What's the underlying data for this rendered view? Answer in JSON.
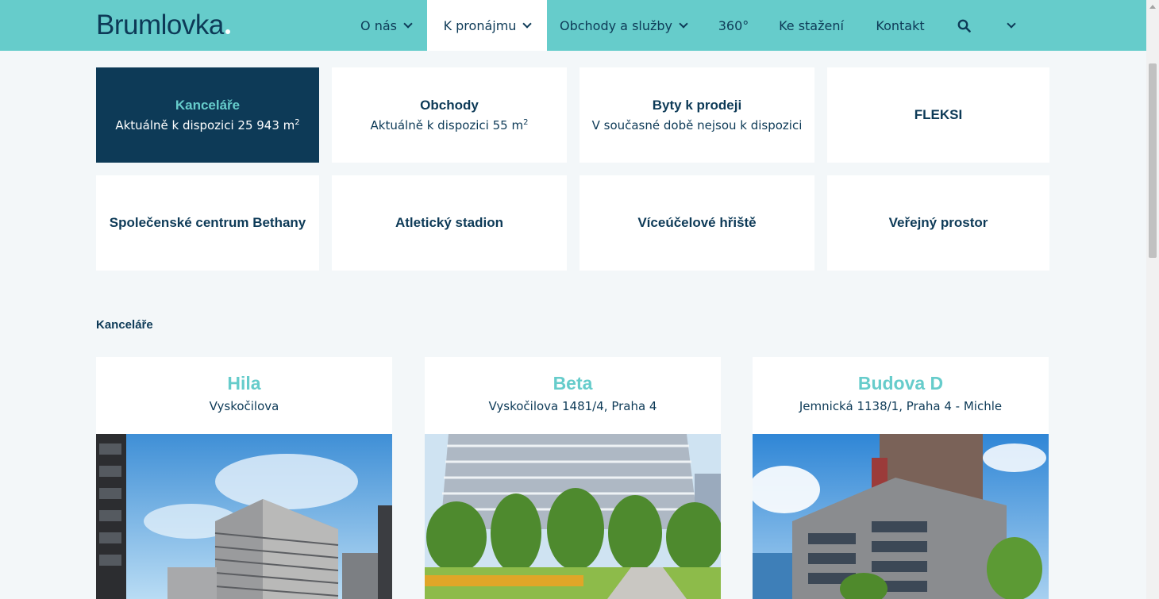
{
  "header": {
    "logo": "Brumlovka",
    "nav": [
      {
        "label": "O nás"
      },
      {
        "label": "K pronájmu"
      },
      {
        "label": "Obchody a služby"
      },
      {
        "label": "360°"
      },
      {
        "label": "Ke stažení"
      },
      {
        "label": "Kontakt"
      }
    ]
  },
  "tiles": [
    {
      "title": "Kanceláře",
      "sub": "Aktuálně k dispozici 25 943 m",
      "sup": "2"
    },
    {
      "title": "Obchody",
      "sub": "Aktuálně k dispozici 55 m",
      "sup": "2"
    },
    {
      "title": "Byty k prodeji",
      "sub": "V současné době nejsou k dispozici"
    },
    {
      "title": "FLEKSI"
    },
    {
      "title": "Společenské centrum Bethany"
    },
    {
      "title": "Atletický stadion"
    },
    {
      "title": "Víceúčelové hřiště"
    },
    {
      "title": "Veřejný prostor"
    }
  ],
  "section_label": "Kanceláře",
  "cards": [
    {
      "name": "Hila",
      "address": "Vyskočilova"
    },
    {
      "name": "Beta",
      "address": "Vyskočilova 1481/4, Praha 4"
    },
    {
      "name": "Budova D",
      "address": "Jemnická 1138/1, Praha 4 - Michle"
    }
  ],
  "colors": {
    "header_bg": "#66cccb",
    "navy": "#0d3a57",
    "page_bg": "#f3f7f9",
    "accent": "#66cccb"
  },
  "icons": [
    "search-icon",
    "chevron-down-icon"
  ]
}
